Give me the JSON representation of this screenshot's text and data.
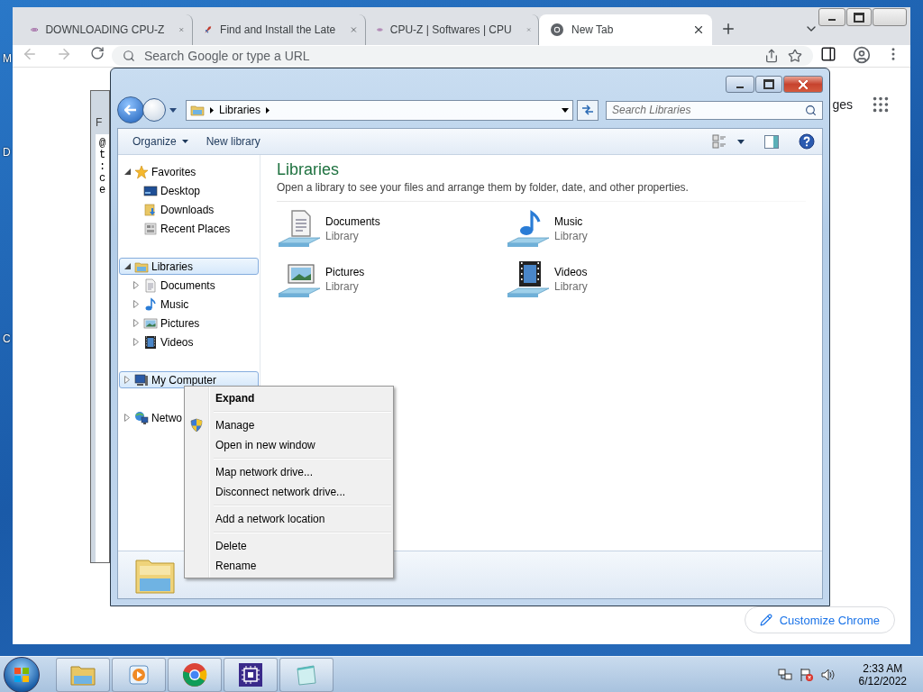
{
  "desktop": {
    "icon_labels": [
      "M",
      "D",
      "C"
    ]
  },
  "browser": {
    "tabs": [
      {
        "title": "DOWNLOADING CPU-Z",
        "selected": false,
        "kind": "cpuid"
      },
      {
        "title": "Find and Install the Late",
        "selected": false,
        "kind": "rocket"
      },
      {
        "title": "CPU-Z | Softwares | CPU",
        "selected": false,
        "kind": "cpuid"
      },
      {
        "title": "New Tab",
        "selected": true,
        "kind": "chrome"
      }
    ],
    "address_placeholder": "Search Google or type a URL",
    "page_link": "ges",
    "customize_button": "Customize Chrome"
  },
  "background_window": {
    "menu": "F",
    "lines": [
      "@",
      "t",
      ":",
      "c",
      "e"
    ]
  },
  "explorer": {
    "breadcrumb": "Libraries",
    "search_placeholder": "Search Libraries",
    "toolbar": [
      "Organize",
      "New library"
    ],
    "nav": [
      {
        "label": "Favorites",
        "kind": "star",
        "expanded": true,
        "selected": false,
        "children": [
          {
            "label": "Desktop",
            "kind": "desktop",
            "selected": false
          },
          {
            "label": "Downloads",
            "kind": "downloads",
            "selected": false
          },
          {
            "label": "Recent Places",
            "kind": "recent",
            "selected": false
          }
        ]
      },
      {
        "label": "Libraries",
        "kind": "library",
        "expanded": true,
        "selected": true,
        "children": [
          {
            "label": "Documents",
            "kind": "documents",
            "expanded": false,
            "selected": false
          },
          {
            "label": "Music",
            "kind": "music",
            "expanded": false,
            "selected": false
          },
          {
            "label": "Pictures",
            "kind": "pictures",
            "expanded": false,
            "selected": false
          },
          {
            "label": "Videos",
            "kind": "videos",
            "expanded": false,
            "selected": false
          }
        ]
      },
      {
        "label": "My Computer",
        "kind": "computer",
        "expanded": false,
        "selected": true
      },
      {
        "label": "Netwo",
        "kind": "network",
        "expanded": false,
        "selected": false
      }
    ],
    "heading": "Libraries",
    "description": "Open a library to see your files and arrange them by folder, date, and other properties.",
    "libraries": [
      {
        "name": "Documents",
        "subtitle": "Library",
        "kind": "documents"
      },
      {
        "name": "Music",
        "subtitle": "Library",
        "kind": "music"
      },
      {
        "name": "Pictures",
        "subtitle": "Library",
        "kind": "pictures"
      },
      {
        "name": "Videos",
        "subtitle": "Library",
        "kind": "videos"
      }
    ]
  },
  "context_menu": {
    "groups": [
      [
        {
          "label": "Expand",
          "default": true
        }
      ],
      [
        {
          "label": "Manage",
          "default": false,
          "kind": "shield"
        },
        {
          "label": "Open in new window",
          "default": false
        }
      ],
      [
        {
          "label": "Map network drive...",
          "default": false
        },
        {
          "label": "Disconnect network drive...",
          "default": false
        }
      ],
      [
        {
          "label": "Add a network location",
          "default": false
        }
      ],
      [
        {
          "label": "Delete",
          "default": false
        },
        {
          "label": "Rename",
          "default": false
        }
      ]
    ]
  },
  "taskbar": {
    "apps": [
      {
        "kind": "explorer"
      },
      {
        "kind": "media"
      },
      {
        "kind": "chrome"
      },
      {
        "kind": "cpuz"
      },
      {
        "kind": "notepad"
      }
    ],
    "time": "2:33 AM",
    "date": "6/12/2022"
  }
}
